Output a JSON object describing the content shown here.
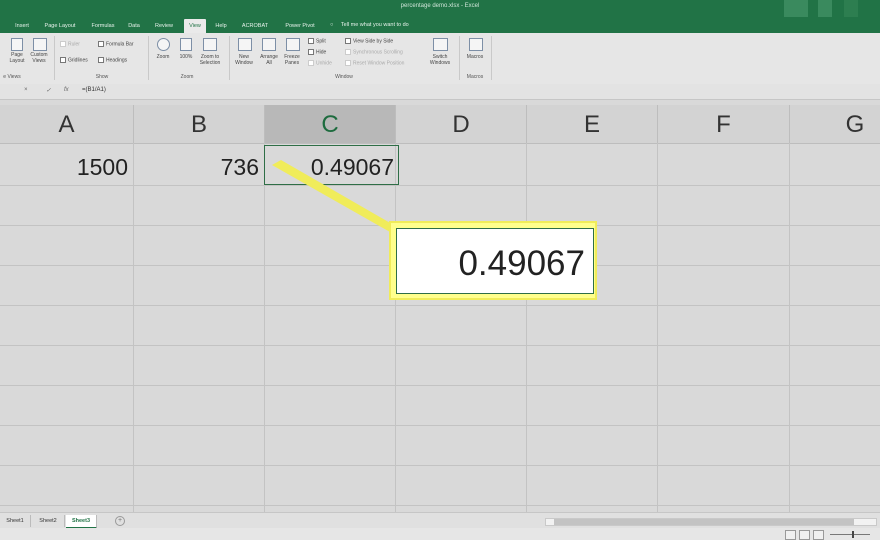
{
  "window": {
    "title": "percentage demo.xlsx  -  Excel"
  },
  "tabs": [
    {
      "label": "Insert"
    },
    {
      "label": "Page Layout"
    },
    {
      "label": "Formulas"
    },
    {
      "label": "Data"
    },
    {
      "label": "Review"
    },
    {
      "label": "View"
    },
    {
      "label": "Help"
    },
    {
      "label": "ACROBAT"
    },
    {
      "label": "Power Pivot"
    }
  ],
  "tell_me": "Tell me what you want to do",
  "ribbon": {
    "workbook_views": {
      "page_layout": "Page Layout",
      "custom_views": "Custom Views",
      "group": "e Views"
    },
    "show": {
      "ruler": "Ruler",
      "gridlines": "Gridlines",
      "formula_bar": "Formula Bar",
      "headings": "Headings",
      "group": "Show"
    },
    "zoom": {
      "zoom": "Zoom",
      "hundred": "100%",
      "zoom_to_selection": "Zoom to Selection",
      "group": "Zoom"
    },
    "window": {
      "new_window": "New Window",
      "arrange_all": "Arrange All",
      "freeze_panes": "Freeze Panes",
      "split": "Split",
      "hide": "Hide",
      "unhide": "Unhide",
      "view_side_by_side": "View Side by Side",
      "sync_scrolling": "Synchronous Scrolling",
      "reset_window_position": "Reset Window Position",
      "switch_windows": "Switch Windows",
      "group": "Window"
    },
    "macros": {
      "macros": "Macros",
      "group": "Macros"
    }
  },
  "formula_bar": {
    "formula": "=(B1/A1)"
  },
  "grid": {
    "columns": [
      "A",
      "B",
      "C",
      "D",
      "E",
      "F",
      "G"
    ],
    "selected_column": "C",
    "row1": {
      "A": "1500",
      "B": "736",
      "C": "0.49067"
    }
  },
  "callout": {
    "value": "0.49067",
    "color": "#f0ec5a"
  },
  "sheets": [
    {
      "label": "Sheet1"
    },
    {
      "label": "Sheet2"
    },
    {
      "label": "Sheet3",
      "active": true
    }
  ],
  "colors": {
    "excel_green": "#217346"
  }
}
